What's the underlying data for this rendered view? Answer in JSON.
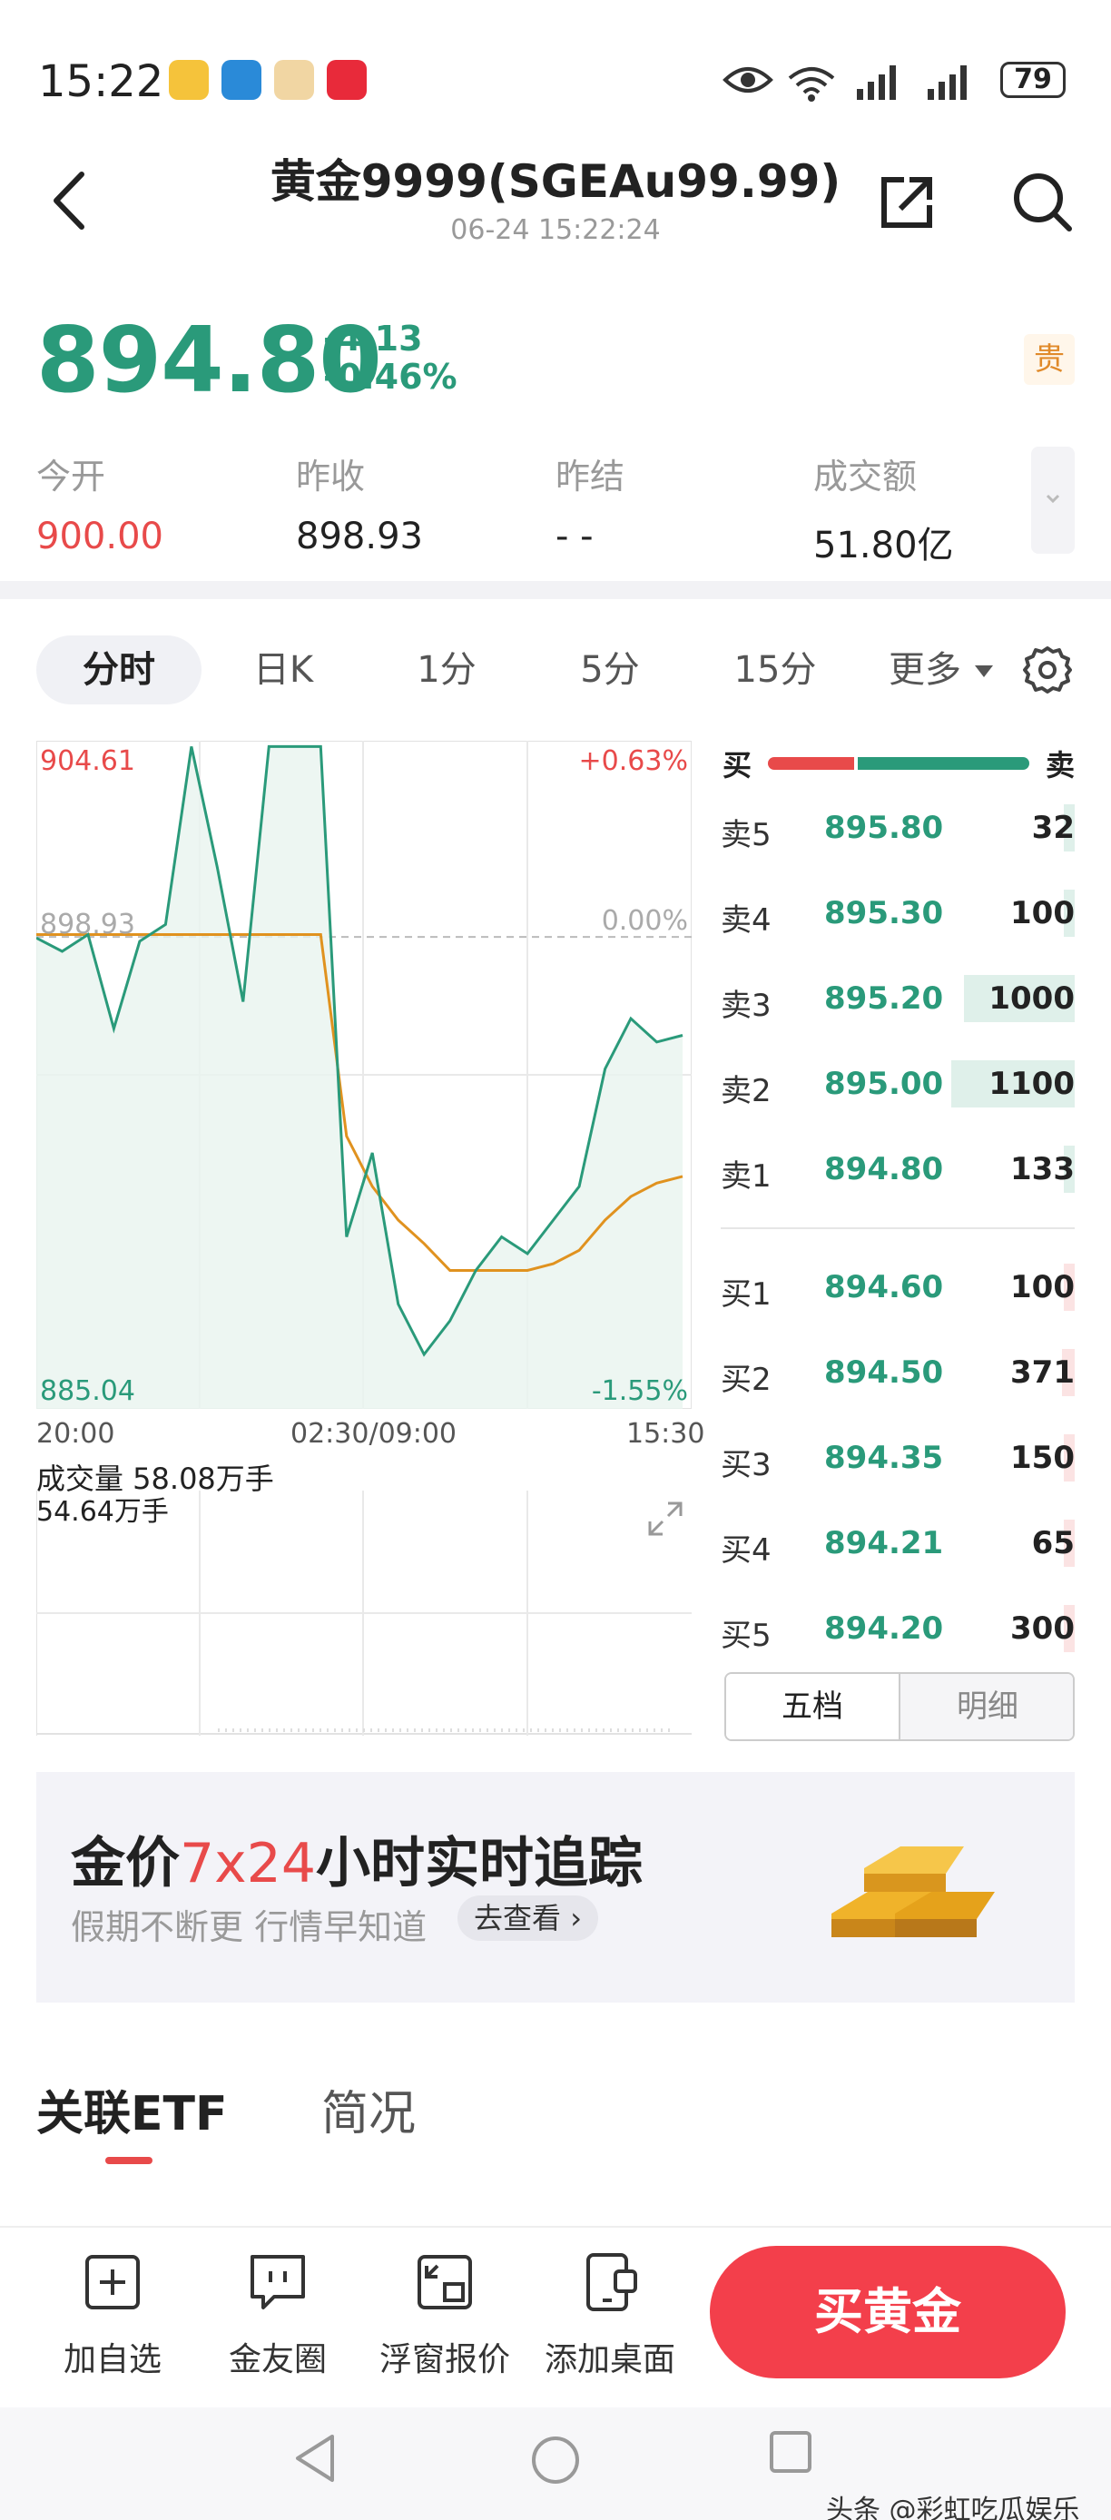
{
  "status_bar": {
    "time": "15:22",
    "battery": "79"
  },
  "header": {
    "title": "黄金9999(SGEAu99.99)",
    "timestamp": "06-24 15:22:24",
    "badge": "贵"
  },
  "quote": {
    "price": "894.80",
    "change": "-4.13",
    "change_pct": "-0.46%",
    "stats": [
      {
        "label": "今开",
        "value": "900.00",
        "color": "#e84a4a"
      },
      {
        "label": "昨收",
        "value": "898.93",
        "color": "#222222"
      },
      {
        "label": "昨结",
        "value": "- -",
        "color": "#222222"
      },
      {
        "label": "成交额",
        "value": "51.80亿",
        "color": "#222222"
      }
    ]
  },
  "tabs": [
    "分时",
    "日K",
    "1分",
    "5分",
    "15分",
    "更多"
  ],
  "chart_data": {
    "type": "line",
    "series": [
      {
        "values": [
          898.9,
          898.5,
          899.0,
          896.2,
          898.8,
          899.3,
          904.6,
          901.0,
          897.0,
          904.6,
          904.6,
          904.6,
          890.0,
          892.5,
          888.0,
          886.5,
          887.5,
          889.0,
          890.0,
          889.5,
          890.5,
          891.5,
          895.0,
          896.5,
          895.8,
          896.0
        ]
      },
      {
        "values": [
          899.0,
          899.0,
          899.0,
          899.0,
          899.0,
          899.0,
          899.0,
          899.0,
          899.0,
          899.0,
          899.0,
          899.0,
          893.0,
          891.5,
          890.5,
          889.8,
          889.0,
          889.0,
          889.0,
          889.0,
          889.2,
          889.6,
          890.5,
          891.2,
          891.6,
          891.8
        ]
      }
    ],
    "ylim": [
      885.04,
      904.61
    ],
    "y_tick_labels": [
      "904.61",
      "898.93",
      "885.04"
    ],
    "pct_labels": [
      "+0.63%",
      "0.00%",
      "-1.55%"
    ],
    "x_tick_labels": [
      "20:00",
      "02:30/09:00",
      "15:30"
    ],
    "volume_title": "成交量 58.08万手",
    "volume_max": "54.64万手",
    "grid": true
  },
  "orderbook": {
    "header_buy": "买",
    "header_sell": "卖",
    "buy_ratio": 0.33,
    "asks": [
      {
        "label": "卖5",
        "price": "895.80",
        "qty": "32",
        "share": 0.02
      },
      {
        "label": "卖4",
        "price": "895.30",
        "qty": "100",
        "share": 0.05
      },
      {
        "label": "卖3",
        "price": "895.20",
        "qty": "1000",
        "share": 0.9
      },
      {
        "label": "卖2",
        "price": "895.00",
        "qty": "1100",
        "share": 1.0
      },
      {
        "label": "卖1",
        "price": "894.80",
        "qty": "133",
        "share": 0.06
      }
    ],
    "bids": [
      {
        "label": "买1",
        "price": "894.60",
        "qty": "100",
        "share": 0.05
      },
      {
        "label": "买2",
        "price": "894.50",
        "qty": "371",
        "share": 0.1
      },
      {
        "label": "买3",
        "price": "894.35",
        "qty": "150",
        "share": 0.06
      },
      {
        "label": "买4",
        "price": "894.21",
        "qty": "65",
        "share": 0.03
      },
      {
        "label": "买5",
        "price": "894.20",
        "qty": "300",
        "share": 0.09
      }
    ],
    "switch": [
      "五档",
      "明细"
    ]
  },
  "banner": {
    "title_a": "金价",
    "title_hl": "7x24",
    "title_b": "小时实时追踪",
    "sub": "假期不断更  行情早知道",
    "pill": "去查看"
  },
  "sections": [
    "关联ETF",
    "简况"
  ],
  "actions": [
    "加自选",
    "金友圈",
    "浮窗报价",
    "添加桌面"
  ],
  "buy_button": "买黄金",
  "watermark": "头条 @彩虹吃瓜娱乐",
  "colors": {
    "green": "#2a9a7a",
    "red": "#e84a4a",
    "orange": "#e0921f",
    "buy_btn": "#f33f4b"
  }
}
